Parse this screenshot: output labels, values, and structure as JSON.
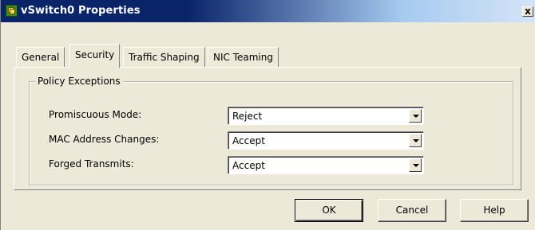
{
  "window": {
    "title": "vSwitch0 Properties",
    "close_glyph": "x",
    "app_icon": "vmware-network-icon"
  },
  "tabs": [
    {
      "label": "General",
      "active": false
    },
    {
      "label": "Security",
      "active": true
    },
    {
      "label": "Traffic Shaping",
      "active": false
    },
    {
      "label": "NIC Teaming",
      "active": false
    }
  ],
  "policy": {
    "group_label": "Policy Exceptions",
    "fields": [
      {
        "label": "Promiscuous Mode:",
        "value": "Reject"
      },
      {
        "label": "MAC Address Changes:",
        "value": "Accept"
      },
      {
        "label": "Forged Transmits:",
        "value": "Accept"
      }
    ]
  },
  "buttons": {
    "ok": "OK",
    "cancel": "Cancel",
    "help": "Help"
  },
  "colors": {
    "titlebar_start": "#0a246a",
    "titlebar_end": "#d4e4f7",
    "dialog_bg": "#ece9d8"
  }
}
